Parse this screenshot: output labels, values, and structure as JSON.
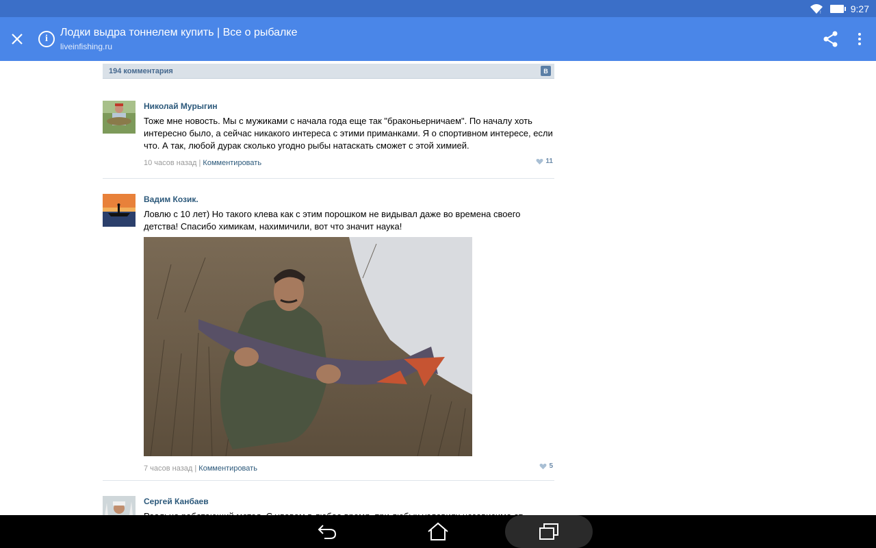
{
  "status_bar": {
    "time": "9:27"
  },
  "toolbar": {
    "title": "Лодки выдра тоннелем купить | Все о рыбалке",
    "url": "liveinfishing.ru"
  },
  "widget": {
    "count_label": "194 комментария",
    "vk_logo": "В"
  },
  "comments": [
    {
      "author": "Николай Мурыгин",
      "text": "Тоже мне новость. Мы с мужиками с начала года еще так \"браконьерничаем\". По началу хоть интересно было, а сейчас никакого интереса с этими приманками. Я о спортивном интересе, если что. А так, любой дурак сколько угодно рыбы натаскать сможет с этой химией.",
      "time": "10 часов назад",
      "separator": " | ",
      "reply_label": "Комментировать",
      "likes": "11"
    },
    {
      "author": "Вадим Козик.",
      "text": "Ловлю с 10 лет) Но такого клева как с этим порошком не видывал даже во времена своего детства! Спасибо химикам, нахимичили, вот что значит наука!",
      "time": "7 часов назад",
      "separator": " | ",
      "reply_label": "Комментировать",
      "likes": "5"
    },
    {
      "author": "Сергей Канбаев",
      "text": "Реально работающий метод. С уловом в любое время, при любых условиях независимо от направления ветра и атмосферного давления!"
    }
  ],
  "colors": {
    "status_bar": "#3b6fc8",
    "toolbar": "#4a86e8",
    "link": "#2b587a",
    "widget_header": "#dae1e8"
  },
  "icons": {
    "close": "close-icon",
    "info": "info-icon",
    "share": "share-icon",
    "menu": "more-vert-icon",
    "back": "back-icon",
    "home": "home-icon",
    "recents": "recents-icon"
  }
}
